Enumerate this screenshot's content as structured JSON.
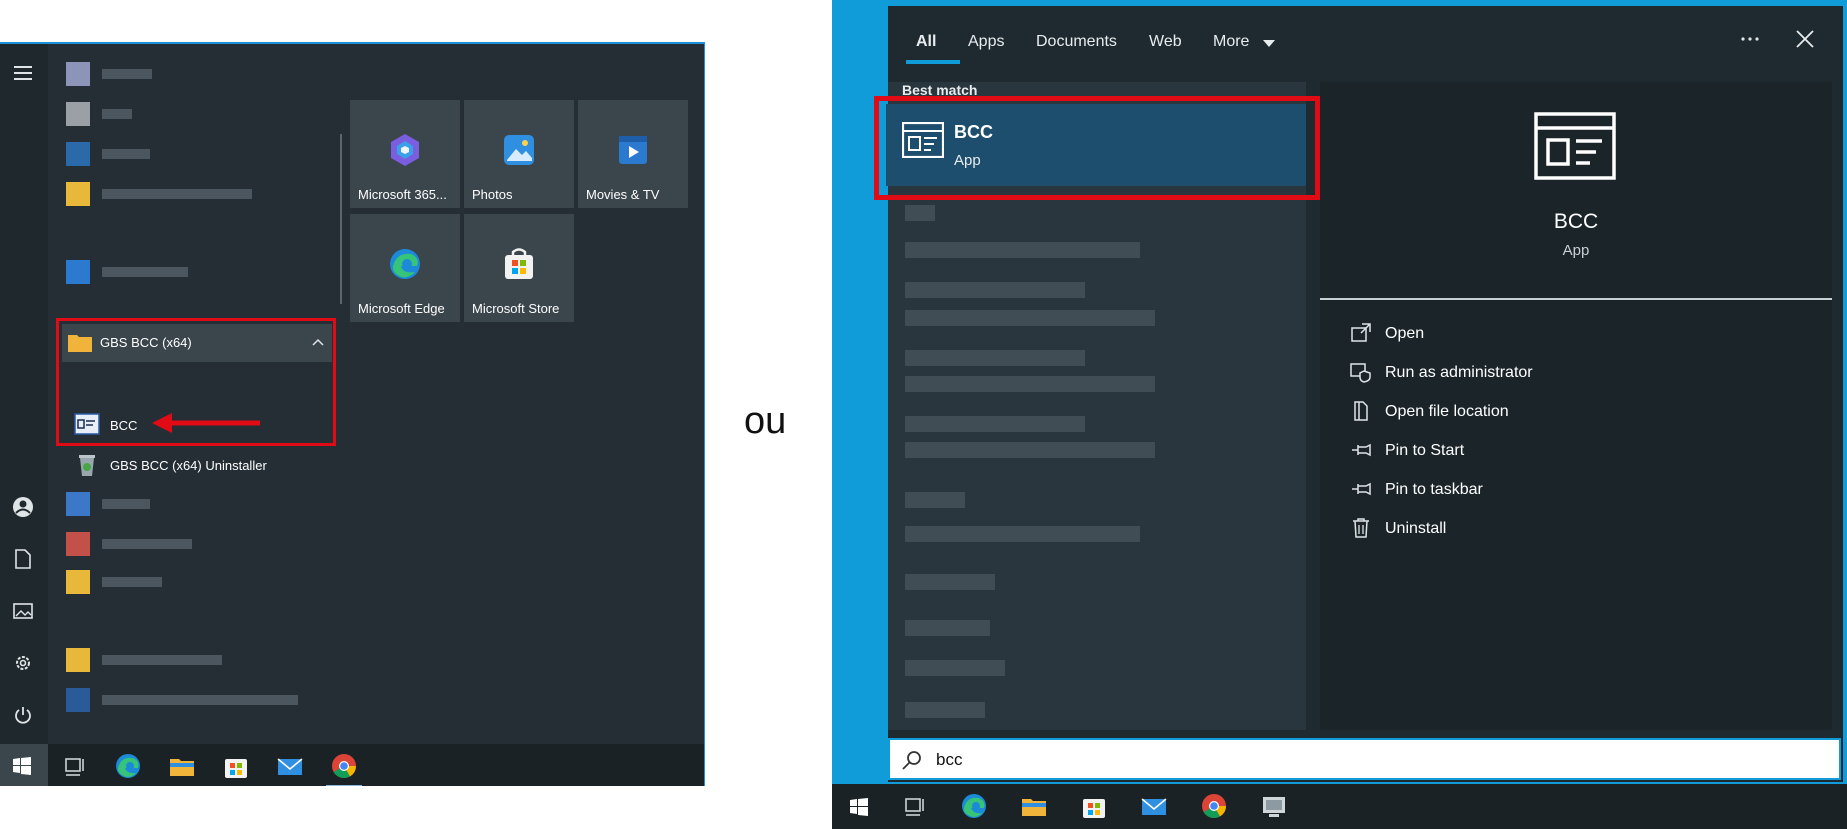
{
  "separator_text": "ou",
  "start_menu": {
    "tiles": [
      {
        "label": "Microsoft 365..."
      },
      {
        "label": "Photos"
      },
      {
        "label": "Movies & TV"
      },
      {
        "label": "Microsoft Edge"
      },
      {
        "label": "Microsoft Store"
      }
    ],
    "folder": {
      "label": "GBS BCC (x64)",
      "items": [
        {
          "label": "BCC",
          "icon": "bcc-app-icon"
        },
        {
          "label": "GBS BCC (x64) Uninstaller",
          "icon": "uninstaller-icon"
        }
      ]
    },
    "rail_icons": [
      "hamburger-icon",
      "user-icon",
      "document-icon",
      "pictures-icon",
      "settings-icon",
      "power-icon"
    ],
    "taskbar_icons": [
      "windows-start-icon",
      "task-view-icon",
      "edge-icon",
      "file-explorer-icon",
      "store-icon",
      "mail-icon",
      "chrome-icon"
    ],
    "highlight_color": "#e00b14"
  },
  "search": {
    "tabs": [
      "All",
      "Apps",
      "Documents",
      "Web",
      "More"
    ],
    "best_match_label": "Best match",
    "result": {
      "name": "BCC",
      "type": "App"
    },
    "detail": {
      "name": "BCC",
      "type": "App"
    },
    "actions": [
      "Open",
      "Run as administrator",
      "Open file location",
      "Pin to Start",
      "Pin to taskbar",
      "Uninstall"
    ],
    "query": "bcc",
    "accent_color": "#0f9cd8",
    "selected_color": "#1e4e6d"
  }
}
